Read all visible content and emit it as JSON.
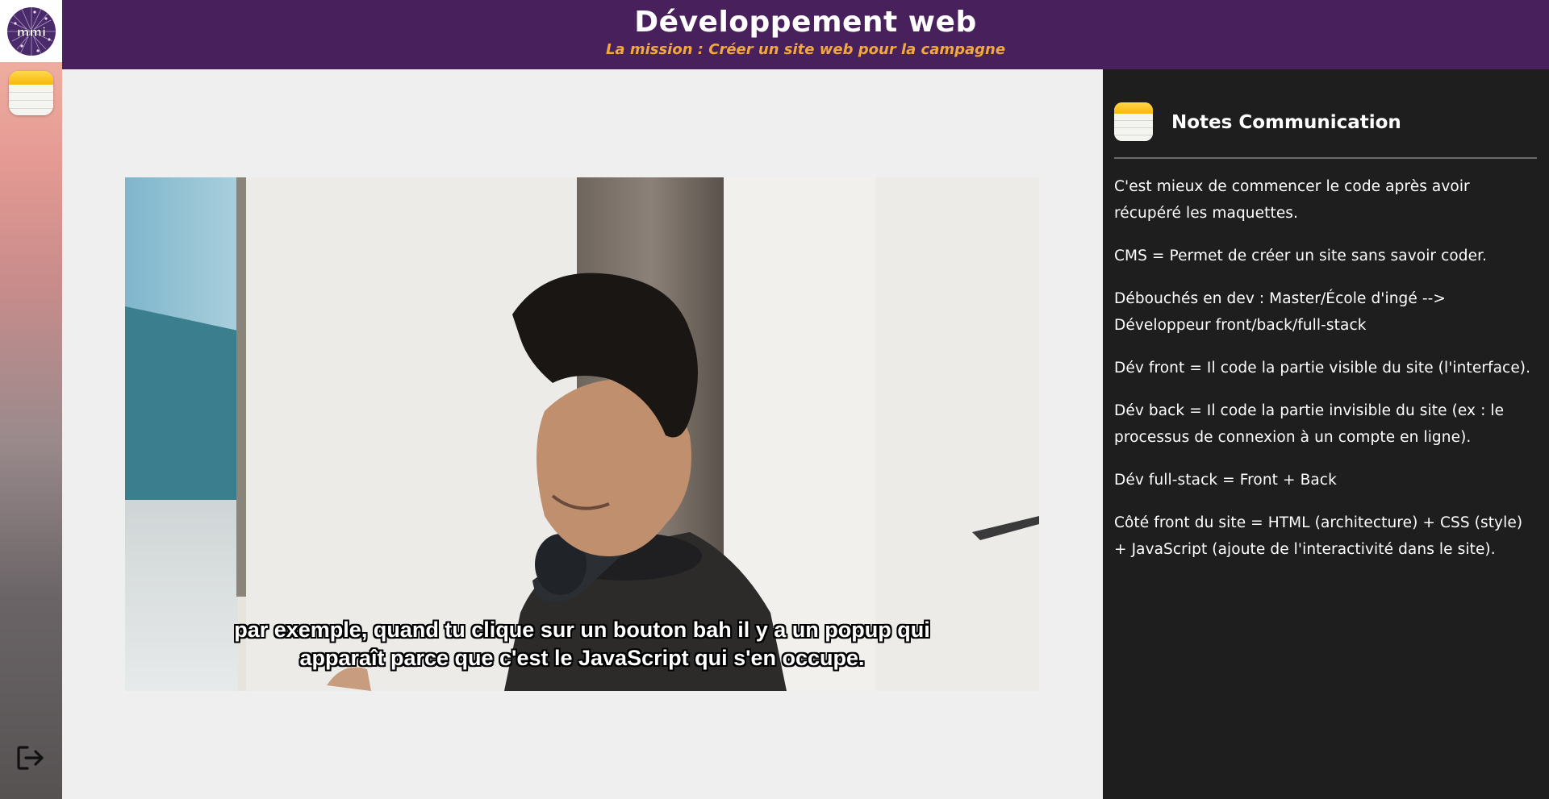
{
  "app": {
    "logo_text": "mmi"
  },
  "header": {
    "title": "Développement web",
    "subtitle": "La mission : Créer un site web pour la campagne"
  },
  "sidebar": {
    "items": [
      {
        "icon": "notes-app-icon"
      },
      {
        "icon": "logout-icon"
      }
    ]
  },
  "video": {
    "caption_line1": "par exemple, quand tu clique sur un bouton bah il y a un popup qui",
    "caption_line2": "apparaît parce que c'est le JavaScript qui s'en occupe."
  },
  "notes_panel": {
    "title": "Notes Communication",
    "icon": "notes-app-icon",
    "notes": [
      "C'est mieux de commencer le code après avoir récupéré les maquettes.",
      "CMS = Permet de créer un site sans savoir coder.",
      "Débouchés en dev : Master/École d'ingé --> Développeur front/back/full-stack",
      "Dév front = Il code la partie visible du site (l'interface).",
      "Dév back = Il code la partie invisible du site (ex : le processus de connexion à un compte en ligne).",
      "Dév full-stack = Front + Back",
      "Côté front du site = HTML (architecture) + CSS (style) + JavaScript (ajoute de l'interactivité dans le site)."
    ]
  },
  "colors": {
    "header_bg": "#48205b",
    "subtitle": "#f2a93b",
    "notes_bg": "#1e1e1e",
    "main_bg": "#efefef"
  }
}
